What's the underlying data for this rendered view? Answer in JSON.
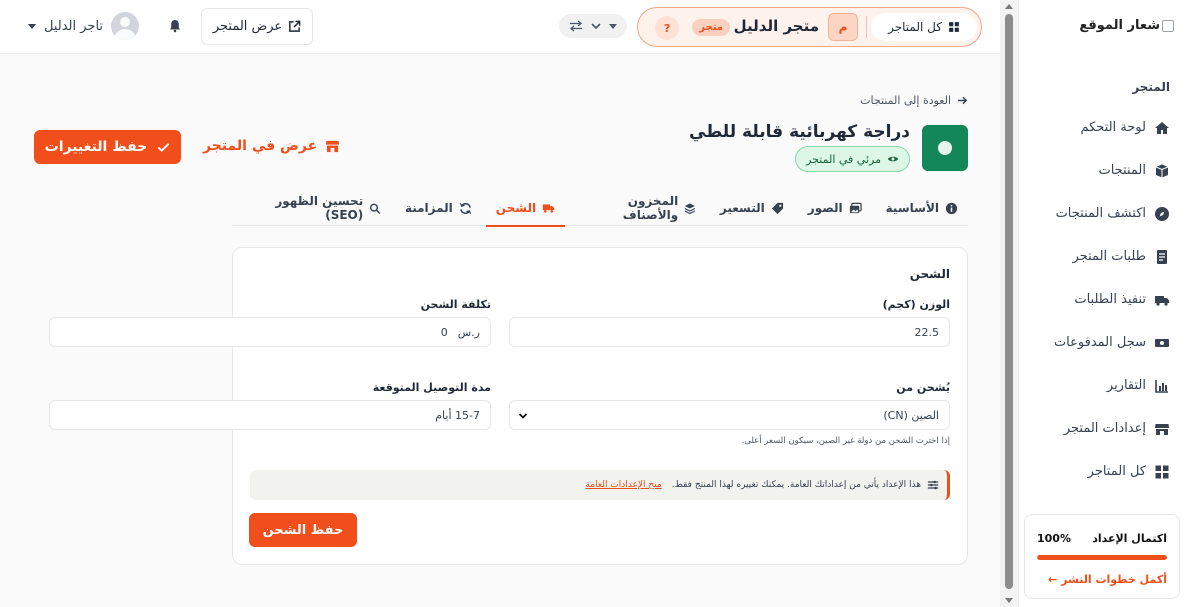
{
  "sidebar": {
    "logo_text": "شعار الموقع",
    "section_label": "المتجر",
    "items": [
      {
        "label": "لوحة التحكم",
        "icon": "home-icon"
      },
      {
        "label": "المنتجات",
        "icon": "box-icon"
      },
      {
        "label": "اكتشف المنتجات",
        "icon": "compass-icon"
      },
      {
        "label": "طلبات المتجر",
        "icon": "receipt-icon"
      },
      {
        "label": "تنفيذ الطلبات",
        "icon": "truck-icon"
      },
      {
        "label": "سجل المدفوعات",
        "icon": "money-icon"
      },
      {
        "label": "التقارير",
        "icon": "chart-icon"
      },
      {
        "label": "إعدادات المتجر",
        "icon": "store-icon"
      },
      {
        "label": "كل المتاجر",
        "icon": "grid-icon"
      }
    ],
    "setup": {
      "label": "اكتمال الإعداد",
      "percent_text": "100%",
      "progress": 1.0,
      "link": "أكمل خطوات النشر ←"
    }
  },
  "topbar": {
    "all_stores": "كل المتاجر",
    "store_initial": "م",
    "store_name": "متجر الدليل",
    "store_badge": "متجر",
    "help": "?",
    "view_store": "عرض المتجر",
    "user_name": "تاجر الدليل"
  },
  "product": {
    "back_link": "العودة إلى المنتجات",
    "title": "دراجة كهربائية قابلة للطي",
    "visibility": "مرئي في المتجر",
    "save_changes": "حفظ التغييرات",
    "view_in_store": "عرض في المتجر"
  },
  "tabs": [
    {
      "label": "الأساسية",
      "icon": "info-icon",
      "active": false
    },
    {
      "label": "الصور",
      "icon": "images-icon",
      "active": false
    },
    {
      "label": "التسعير",
      "icon": "tag-icon",
      "active": false
    },
    {
      "label": "المخزون والأصناف",
      "icon": "layers-icon",
      "active": false
    },
    {
      "label": "الشحن",
      "icon": "truck-icon",
      "active": true
    },
    {
      "label": "المزامنة",
      "icon": "sync-icon",
      "active": false
    },
    {
      "label": "تحسين الظهور (SEO)",
      "icon": "search-icon",
      "active": false
    }
  ],
  "shipping": {
    "title": "الشحن",
    "weight_label": "الوزن (كجم)",
    "weight_value": "22.5",
    "cost_label": "تكلفة الشحن",
    "cost_currency": "ر.س",
    "cost_value": "0",
    "ship_from_label": "يُشحن من",
    "ship_from_value": "الصين (CN)",
    "delivery_label": "مدة التوصيل المتوقعة",
    "delivery_value": "15-7 أيام",
    "hint": "إذا اخترت الشحن من دولة غير الصين، سيكون السعر أعلى.",
    "note_text": "هذا الإعداد يأتي من إعداداتك العامة. يمكنك تغييره لهذا المنتج فقط.",
    "note_link": "منح الإعدادات العامة",
    "save_button": "حفظ الشحن"
  },
  "colors": {
    "accent": "#f04e1a",
    "success": "#16603a"
  }
}
